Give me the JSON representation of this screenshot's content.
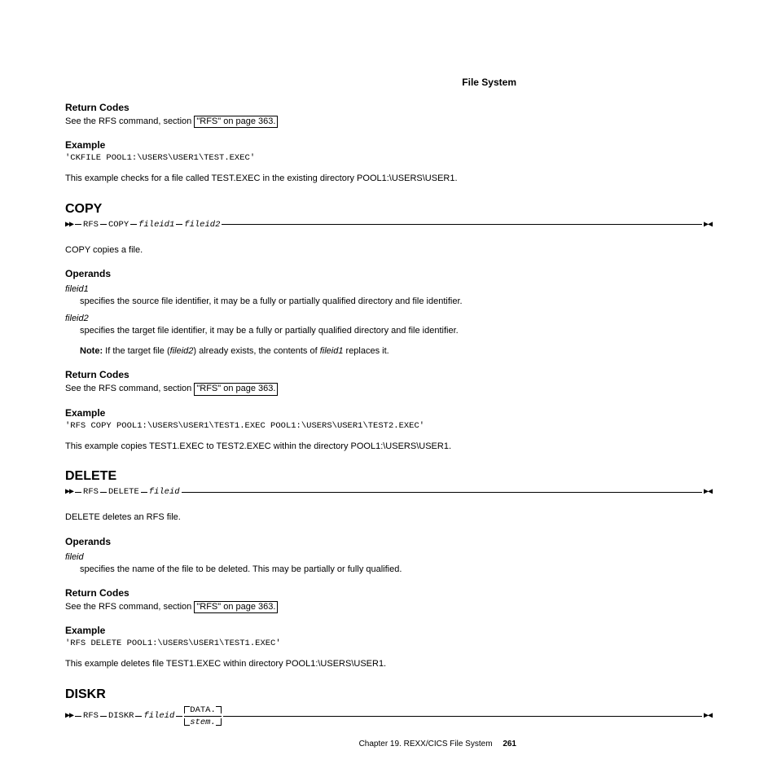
{
  "header": {
    "right": "File System"
  },
  "s1": {
    "returnCodes": {
      "title": "Return Codes",
      "text": "See the RFS command, section ",
      "link": "\"RFS\" on page 363."
    },
    "example": {
      "title": "Example",
      "code": "'CKFILE POOL1:\\USERS\\USER1\\TEST.EXEC'",
      "desc": "This example checks for a file called TEST.EXEC in the existing directory POOL1:\\USERS\\USER1."
    }
  },
  "copy": {
    "title": "COPY",
    "syntax": {
      "prefix": "RFS",
      "cmd": "COPY",
      "op1": "fileid1",
      "op2": "fileid2"
    },
    "desc": "COPY copies a file.",
    "operands": {
      "title": "Operands",
      "items": [
        {
          "term": "fileid1",
          "def": "specifies the source file identifier, it may be a fully or partially qualified directory and file identifier."
        },
        {
          "term": "fileid2",
          "def": "specifies the target file identifier, it may be a fully or partially qualified directory and file identifier."
        }
      ],
      "noteLabel": "Note:",
      "notePre": " If the target file (",
      "noteOp2": "fileid2",
      "noteMid": ") already exists, the contents of ",
      "noteOp1": "fileid1",
      "notePost": " replaces it."
    },
    "returnCodes": {
      "title": "Return Codes",
      "text": "See the RFS command, section ",
      "link": "\"RFS\" on page 363."
    },
    "example": {
      "title": "Example",
      "code": "'RFS COPY POOL1:\\USERS\\USER1\\TEST1.EXEC POOL1:\\USERS\\USER1\\TEST2.EXEC'",
      "desc": "This example copies TEST1.EXEC to TEST2.EXEC within the directory POOL1:\\USERS\\USER1."
    }
  },
  "delete": {
    "title": "DELETE",
    "syntax": {
      "prefix": "RFS",
      "cmd": "DELETE",
      "op1": "fileid"
    },
    "desc": "DELETE deletes an RFS file.",
    "operands": {
      "title": "Operands",
      "items": [
        {
          "term": "fileid",
          "def": "specifies the name of the file to be deleted. This may be partially or fully qualified."
        }
      ]
    },
    "returnCodes": {
      "title": "Return Codes",
      "text": "See the RFS command, section ",
      "link": "\"RFS\" on page 363."
    },
    "example": {
      "title": "Example",
      "code": "'RFS DELETE POOL1:\\USERS\\USER1\\TEST1.EXEC'",
      "desc": "This example deletes file TEST1.EXEC within directory POOL1:\\USERS\\USER1."
    }
  },
  "diskr": {
    "title": "DISKR",
    "syntax": {
      "prefix": "RFS",
      "cmd": "DISKR",
      "op1": "fileid",
      "opt1": "DATA.",
      "opt2": "stem."
    }
  },
  "footer": {
    "chapter": "Chapter 19. REXX/CICS File System",
    "page": "261"
  }
}
